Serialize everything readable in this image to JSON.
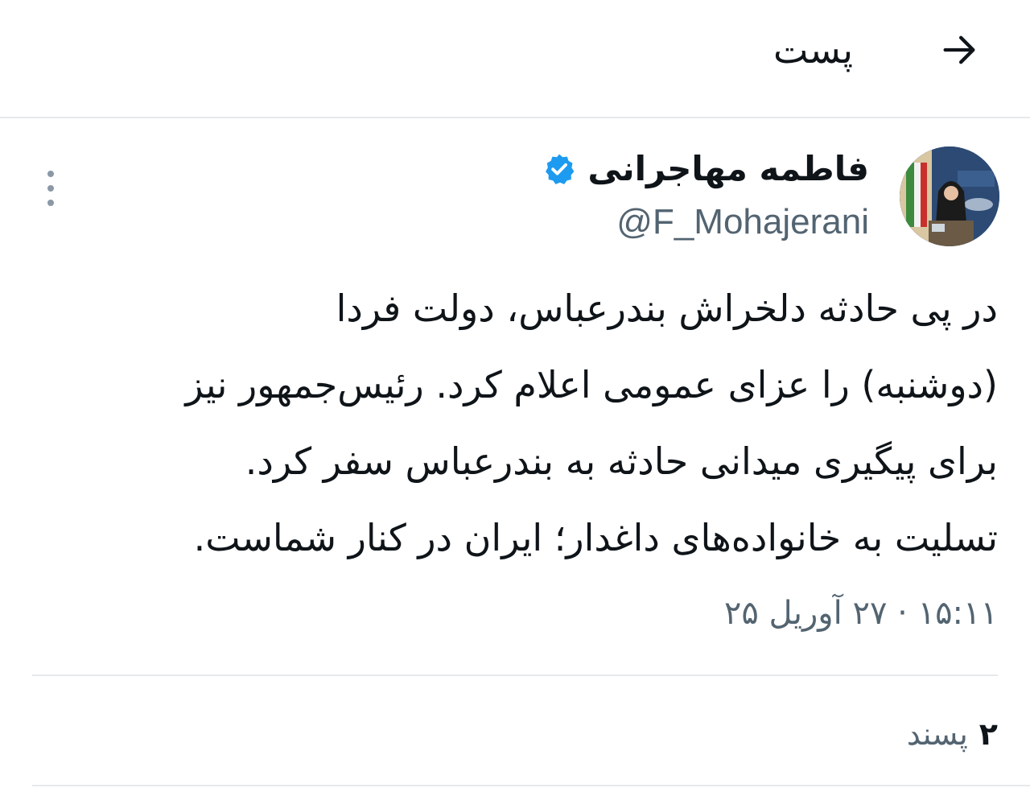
{
  "header": {
    "title": "پست",
    "back_icon": "arrow-right-icon"
  },
  "tweet": {
    "author_name": "فاطمه مهاجرانی",
    "verified_icon": "verified-badge-icon",
    "verified_color": "#1d9bf0",
    "handle": "@F_Mohajerani",
    "more_icon": "more-vertical-icon",
    "text_lines": [
      "در پی حادثه دلخراش بندرعباس، دولت فردا",
      "(دوشنبه) را عزای عمومی اعلام کرد. رئیس‌جمهور نیز",
      "برای پیگیری میدانی حادثه به بندرعباس سفر کرد.",
      "تسلیت به خانواده‌های داغدار؛ ایران در کنار شماست."
    ],
    "timestamp": "۱۵:۱۱ · ۲۷ آوریل ۲۵"
  },
  "stats": {
    "likes_count": "۲",
    "likes_label": "پسند"
  },
  "colors": {
    "text": "#0f1419",
    "muted": "#536471",
    "divider": "#e6e9ec"
  }
}
